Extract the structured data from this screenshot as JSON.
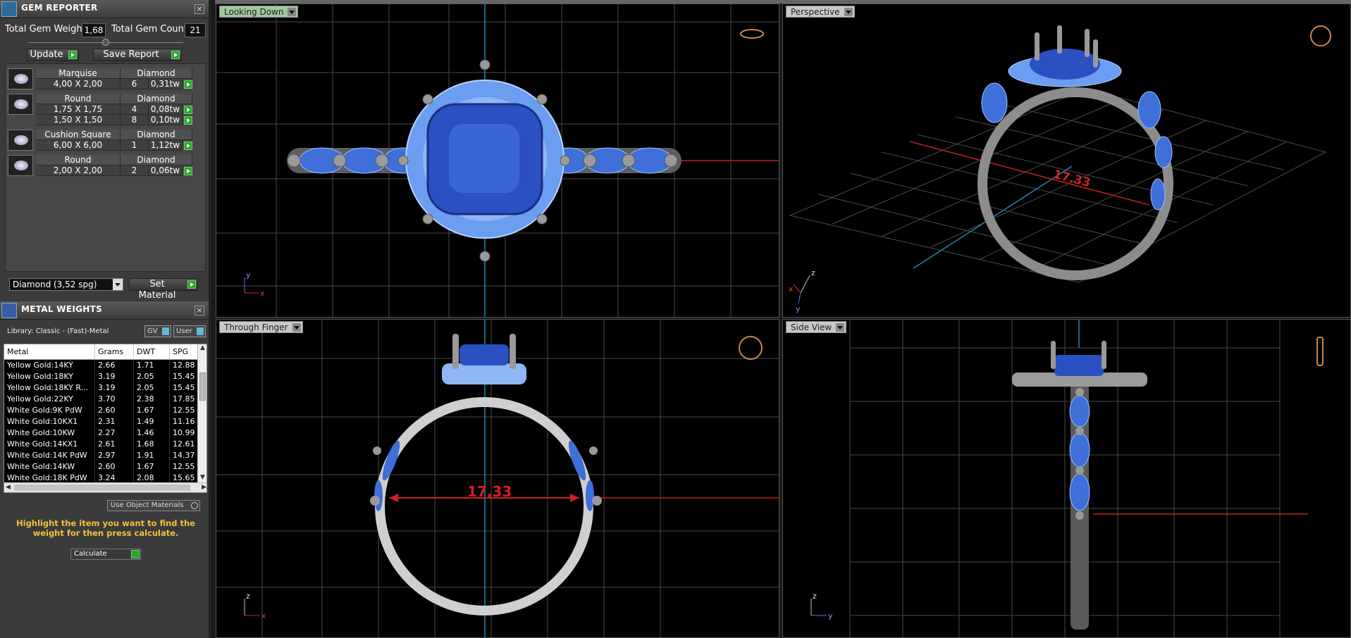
{
  "gem_reporter": {
    "title": "GEM REPORTER",
    "total_weight_label": "Total Gem Weight",
    "total_weight_value": "1,68",
    "total_count_label": "Total Gem Count",
    "total_count_value": "21",
    "update_label": "Update",
    "save_report_label": "Save Report",
    "gems": [
      {
        "shape": "Marquise",
        "material": "Diamond",
        "rows": [
          {
            "size": "4,00 X 2,00",
            "count": "6",
            "tw": "0,31tw"
          }
        ]
      },
      {
        "shape": "Round",
        "material": "Diamond",
        "rows": [
          {
            "size": "1,75 X 1,75",
            "count": "4",
            "tw": "0,08tw"
          },
          {
            "size": "1,50 X 1,50",
            "count": "8",
            "tw": "0,10tw"
          }
        ]
      },
      {
        "shape": "Cushion Square",
        "material": "Diamond",
        "rows": [
          {
            "size": "6,00 X 6,00",
            "count": "1",
            "tw": "1,12tw"
          }
        ]
      },
      {
        "shape": "Round",
        "material": "Diamond",
        "rows": [
          {
            "size": "2,00 X 2,00",
            "count": "2",
            "tw": "0,06tw"
          }
        ]
      }
    ],
    "material_select": "Diamond    (3,52 spg)",
    "set_material_label": "Set Material"
  },
  "metal_weights": {
    "title": "METAL WEIGHTS",
    "library": "Library: Classic - (Fast)-Metal",
    "gv_label": "GV",
    "user_label": "User",
    "columns": [
      "Metal",
      "Grams",
      "DWT",
      "SPG"
    ],
    "rows": [
      [
        "Yellow Gold:14KY",
        "2.66",
        "1.71",
        "12.88"
      ],
      [
        "Yellow Gold:18KY",
        "3.19",
        "2.05",
        "15.45"
      ],
      [
        "Yellow Gold:18KY R...",
        "3.19",
        "2.05",
        "15.45"
      ],
      [
        "Yellow Gold:22KY",
        "3.70",
        "2.38",
        "17.85"
      ],
      [
        "White Gold:9K PdW",
        "2.60",
        "1.67",
        "12.55"
      ],
      [
        "White Gold:10KX1",
        "2.31",
        "1.49",
        "11.16"
      ],
      [
        "White Gold:10KW",
        "2.27",
        "1.46",
        "10.99"
      ],
      [
        "White Gold:14KX1",
        "2.61",
        "1.68",
        "12.61"
      ],
      [
        "White Gold:14K PdW",
        "2.97",
        "1.91",
        "14.37"
      ],
      [
        "White Gold:14KW",
        "2.60",
        "1.67",
        "12.55"
      ],
      [
        "White Gold:18K PdW",
        "3.24",
        "2.08",
        "15.65"
      ]
    ],
    "use_object_materials": "Use Object Materials",
    "hint": "Highlight the item you want to find the weight for then press calculate.",
    "calculate_select": "Calculate"
  },
  "viewports": {
    "top_left": "Looking Down",
    "top_right": "Perspective",
    "bottom_left": "Through Finger",
    "bottom_right": "Side View",
    "dimension": "17,33",
    "dimension_persp": "17.33"
  },
  "colors": {
    "gem_blue": "#2f54c8",
    "accent_blue": "#6fa0ff",
    "metal": "#8c8c8c",
    "dimension_red": "#d02020",
    "grid": "#5a5a5a"
  }
}
